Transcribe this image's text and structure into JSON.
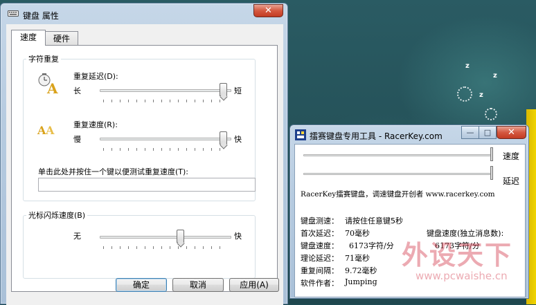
{
  "keyboard_window": {
    "title": "键盘 属性",
    "close_symbol": "✕",
    "tabs": [
      {
        "label": "速度",
        "active": true
      },
      {
        "label": "硬件",
        "active": false
      }
    ],
    "char_repeat": {
      "group_title": "字符重复",
      "repeat_delay": {
        "label": "重复延迟(D):",
        "left": "长",
        "right": "短",
        "level": 1.0
      },
      "repeat_rate": {
        "label": "重复速度(R):",
        "left": "慢",
        "right": "快",
        "level": 1.0
      },
      "test_prompt": "单击此处并按住一个键以便测试重复速度(T):",
      "test_value": ""
    },
    "cursor_blink": {
      "group_title": "光标闪烁速度(B)",
      "left": "无",
      "right": "快",
      "level": 0.6
    },
    "buttons": {
      "ok": "确定",
      "cancel": "取消",
      "apply": "应用(A)"
    }
  },
  "racerkey_window": {
    "title": "擂赛键盘专用工具 - RacerKey.com",
    "caption_buttons": {
      "minimize": "—",
      "maximize": "□",
      "close": "✕"
    },
    "speed_label": "速度",
    "delay_label": "延迟",
    "speed_level": 1.0,
    "delay_level": 1.0,
    "tagline": "RacerKey擂赛键盘，调速键盘开创者 www.racerkey.com",
    "test_label": "键盘测速：",
    "test_value": "请按住任意键5秒",
    "first_delay_label": "首次延迟：",
    "first_delay_value": "70毫秒",
    "speed_row_label": "键盘速度：",
    "speed_row_value": "6173字符/分",
    "independent_label": "键盘速度(独立消息数):",
    "independent_value": "6173字符/分",
    "theory_label": "理论延迟：",
    "theory_value": "71毫秒",
    "interval_label": "重复间隔：",
    "interval_value": "9.72毫秒",
    "author_label": "软件作者：",
    "author_value": "Jumping"
  },
  "watermark": {
    "text": "外设天下",
    "url": "www.pcwaishe.cn"
  },
  "desktop": {
    "z_marks": [
      "z",
      "z",
      "z"
    ]
  },
  "colors": {
    "close_red": "#c23b22",
    "window_frame": "#b6cbe0",
    "desktop_teal": "#245057",
    "watermark_pink": "#d6485a"
  }
}
